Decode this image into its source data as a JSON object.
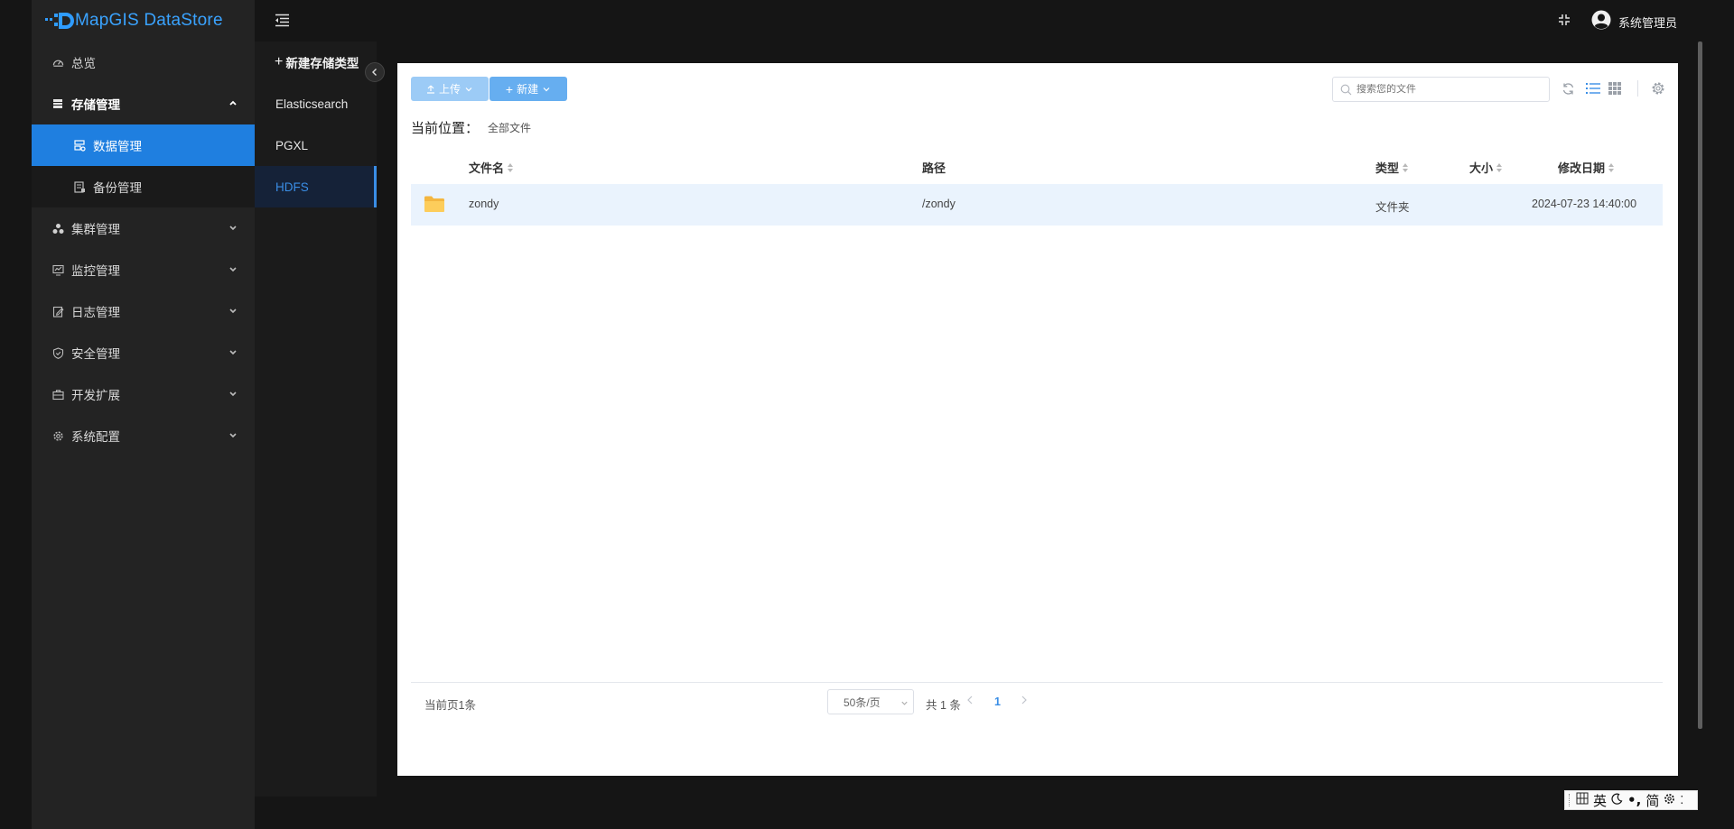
{
  "app": {
    "title": "MapGIS DataStore",
    "user": "系统管理员"
  },
  "colors": {
    "accent": "#1f7fe0",
    "link": "#3a8ee6",
    "sidebar_bg": "#232323",
    "folder": "#f8c44f"
  },
  "sidebar": {
    "items": [
      {
        "label": "总览",
        "icon": "dashboard-icon"
      },
      {
        "label": "存储管理",
        "icon": "storage-icon",
        "expanded": true,
        "children": [
          {
            "label": "数据管理",
            "icon": "data-icon",
            "active": true
          },
          {
            "label": "备份管理",
            "icon": "backup-icon"
          }
        ]
      },
      {
        "label": "集群管理",
        "icon": "cluster-icon"
      },
      {
        "label": "监控管理",
        "icon": "monitor-icon"
      },
      {
        "label": "日志管理",
        "icon": "log-icon"
      },
      {
        "label": "安全管理",
        "icon": "shield-icon"
      },
      {
        "label": "开发扩展",
        "icon": "briefcase-icon"
      },
      {
        "label": "系统配置",
        "icon": "gear-icon"
      }
    ]
  },
  "storage_types": {
    "new_label": "新建存储类型",
    "items": [
      "Elasticsearch",
      "PGXL",
      "HDFS"
    ],
    "active": "HDFS"
  },
  "toolbar": {
    "upload_label": "上传",
    "new_label": "新建",
    "search_placeholder": "搜索您的文件"
  },
  "breadcrumb": {
    "label": "当前位置：",
    "value": "全部文件"
  },
  "table": {
    "headers": {
      "name": "文件名",
      "path": "路径",
      "type": "类型",
      "size": "大小",
      "modified": "修改日期"
    },
    "rows": [
      {
        "name": "zondy",
        "path": "/zondy",
        "type": "文件夹",
        "size": "",
        "modified": "2024-07-23 14:40:00"
      }
    ]
  },
  "pagination": {
    "current_info": "当前页1条",
    "page_size": "50条/页",
    "total": "共 1 条",
    "current_page": "1"
  },
  "ime": {
    "items": [
      "英",
      "简"
    ]
  }
}
